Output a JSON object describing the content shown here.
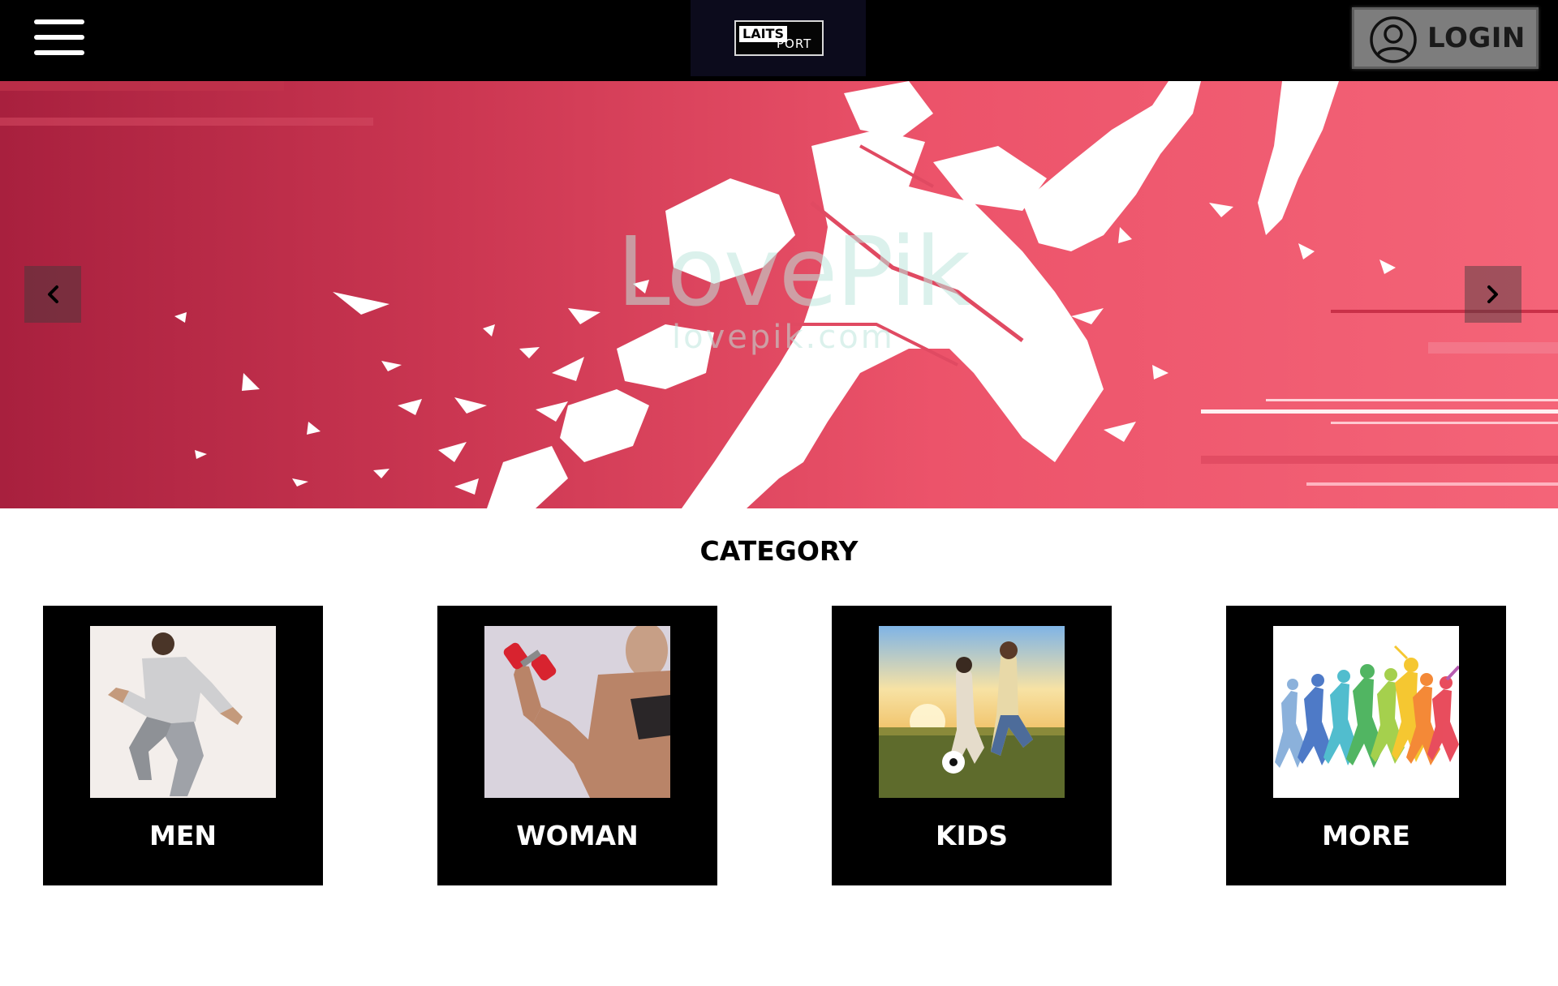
{
  "header": {
    "logo": {
      "word1": "LAITS",
      "word2": "PORT"
    },
    "login_label": "LOGIN"
  },
  "hero": {
    "watermark": "LovePik",
    "watermark_url": "lovepik.com",
    "prev_label": "‹",
    "next_label": "›"
  },
  "category": {
    "title": "CATEGORY",
    "items": [
      {
        "label": "MEN",
        "image": "man-athlete-photo"
      },
      {
        "label": "WOMAN",
        "image": "woman-dumbbell-photo"
      },
      {
        "label": "KIDS",
        "image": "kids-soccer-photo"
      },
      {
        "label": "MORE",
        "image": "colorful-sports-silhouettes"
      }
    ]
  },
  "colors": {
    "header_bg": "#000000",
    "hero_red": "#e04a62",
    "card_bg": "#000000",
    "login_bg": "#7d7d7d"
  }
}
